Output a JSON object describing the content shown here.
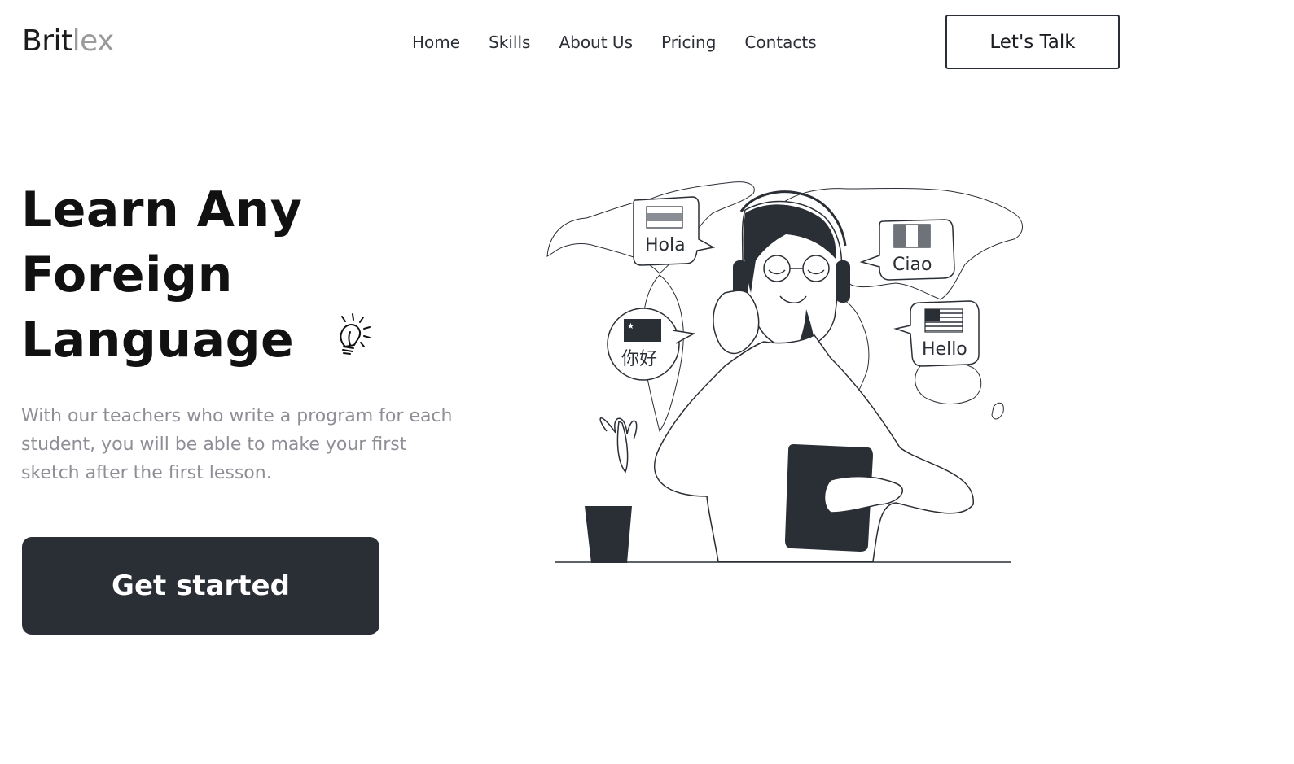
{
  "header": {
    "logo_part1": "Brit",
    "logo_part2": "lex",
    "nav": [
      "Home",
      "Skills",
      "About Us",
      "Pricing",
      "Contacts"
    ],
    "cta_label": "Let's Talk"
  },
  "hero": {
    "title_line1": "Learn Any",
    "title_line2": "Foreign",
    "title_line3": "Language",
    "description": "With our teachers who write a program for each student, you will be able to make your first sketch after the first lesson.",
    "button_label": "Get started"
  },
  "illustration": {
    "bubbles": [
      "Hola",
      "Ciao",
      "你好",
      "Hello"
    ],
    "icons": [
      "lightbulb-icon",
      "world-map",
      "headphones",
      "tablet",
      "plant"
    ]
  },
  "colors": {
    "accent_dark": "#2a2f36",
    "text_muted": "#8e8e96",
    "logo_light": "#9a9a9a"
  }
}
